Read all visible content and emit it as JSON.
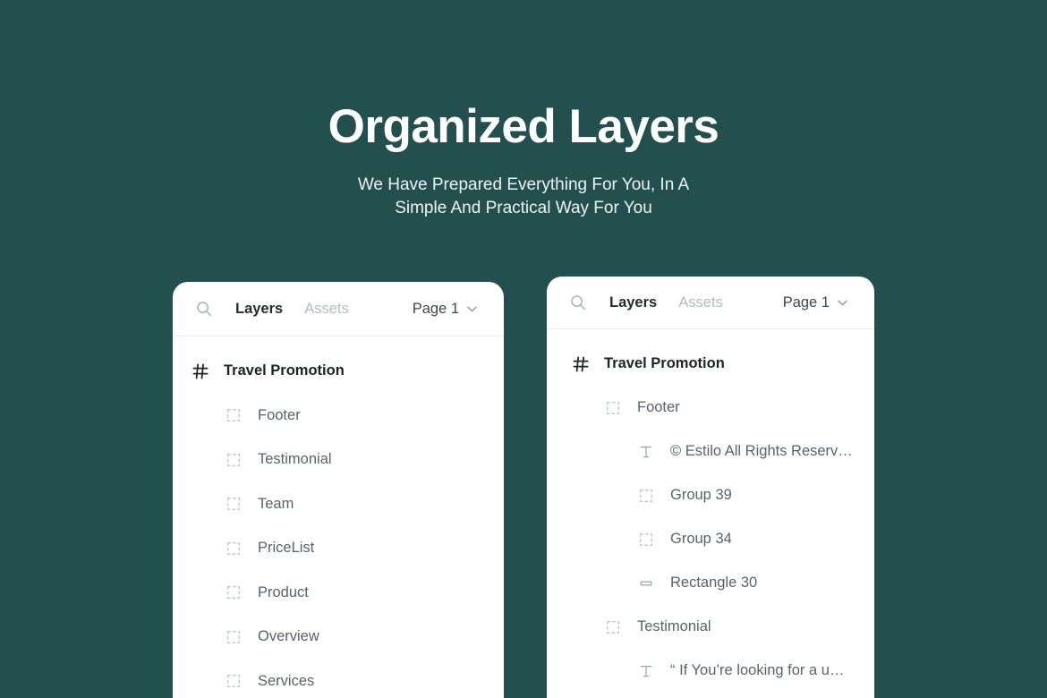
{
  "hero": {
    "title": "Organized Layers",
    "subtitle_line1": "We Have Prepared Everything For You, In A",
    "subtitle_line2": "Simple And Practical Way For You"
  },
  "colors": {
    "background": "#23504f",
    "panel": "#ffffff",
    "title": "#ffffff",
    "tab_active": "#262b2e",
    "tab_inactive": "#b3bbbf",
    "layer_text": "#59636b",
    "frame_text": "#1d2326",
    "divider": "#e9edee"
  },
  "panels": [
    {
      "name": "left-panel",
      "header": {
        "search_icon": "search-icon",
        "tabs": [
          {
            "label": "Layers",
            "active": true
          },
          {
            "label": "Assets",
            "active": false
          }
        ],
        "page_label": "Page 1",
        "page_chevron_icon": "chevron-down-icon"
      },
      "layers": [
        {
          "label": "Travel Promotion",
          "depth": 0,
          "kind": "frame",
          "icon": "hash-icon"
        },
        {
          "label": "Footer",
          "depth": 1,
          "kind": "group",
          "icon": "group-icon"
        },
        {
          "label": "Testimonial",
          "depth": 1,
          "kind": "group",
          "icon": "group-icon"
        },
        {
          "label": "Team",
          "depth": 1,
          "kind": "group",
          "icon": "group-icon"
        },
        {
          "label": "PriceList",
          "depth": 1,
          "kind": "group",
          "icon": "group-icon"
        },
        {
          "label": "Product",
          "depth": 1,
          "kind": "group",
          "icon": "group-icon"
        },
        {
          "label": "Overview",
          "depth": 1,
          "kind": "group",
          "icon": "group-icon"
        },
        {
          "label": "Services",
          "depth": 1,
          "kind": "group",
          "icon": "group-icon"
        }
      ]
    },
    {
      "name": "right-panel",
      "header": {
        "search_icon": "search-icon",
        "tabs": [
          {
            "label": "Layers",
            "active": true
          },
          {
            "label": "Assets",
            "active": false
          }
        ],
        "page_label": "Page 1",
        "page_chevron_icon": "chevron-down-icon"
      },
      "layers": [
        {
          "label": "Travel Promotion",
          "depth": 0,
          "kind": "frame",
          "icon": "hash-icon"
        },
        {
          "label": "Footer",
          "depth": 1,
          "kind": "group",
          "icon": "group-icon"
        },
        {
          "label": "© Estilo All Rights Reserv…",
          "depth": 2,
          "kind": "text",
          "icon": "text-icon"
        },
        {
          "label": "Group 39",
          "depth": 2,
          "kind": "group",
          "icon": "group-icon"
        },
        {
          "label": "Group 34",
          "depth": 2,
          "kind": "group",
          "icon": "group-icon"
        },
        {
          "label": "Rectangle 30",
          "depth": 2,
          "kind": "rect",
          "icon": "rectangle-icon"
        },
        {
          "label": "Testimonial",
          "depth": 1,
          "kind": "group",
          "icon": "group-icon"
        },
        {
          "label": "“ If You’re looking for a u…",
          "depth": 2,
          "kind": "text",
          "icon": "text-icon"
        }
      ]
    }
  ]
}
